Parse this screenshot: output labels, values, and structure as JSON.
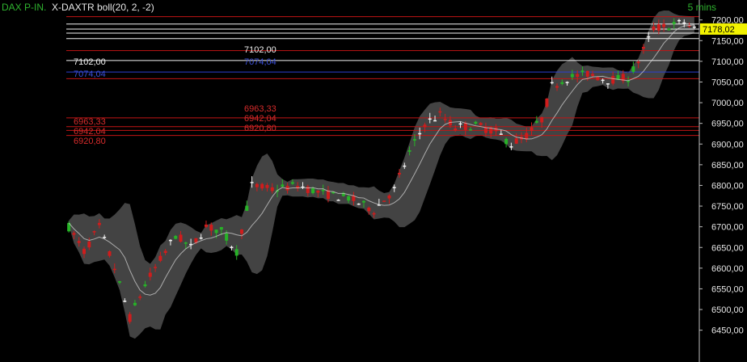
{
  "header": {
    "instrument": "DAX P-IN.",
    "indicator": "X-DAXTR boll(20, 2, -2)",
    "timeframe": "5 mins"
  },
  "colors": {
    "background": "#000000",
    "bull": "#27b327",
    "bear": "#d01c1c",
    "doji": "#f2f2f2",
    "band_fill": "#5a5a5a",
    "middle_band": "#d8d8d8",
    "line_red": "#c21515",
    "line_white": "#f4f4f4",
    "line_blue": "#2c3fd0",
    "current_price_bg": "#f2f200"
  },
  "chart_data": {
    "type": "candlestick",
    "ylim": [
      6420,
      7215
    ],
    "y_ticks": [
      "7200,00",
      "7150,00",
      "7100,00",
      "7050,00",
      "7000,00",
      "6950,00",
      "6900,00",
      "6850,00",
      "6800,00",
      "6750,00",
      "6700,00",
      "6650,00",
      "6600,00",
      "6550,00",
      "6500,00",
      "6450,00"
    ],
    "current_price": {
      "value": 7178.02,
      "label": "7178,02"
    },
    "horizontal_lines": [
      {
        "value": 7208,
        "color": "red",
        "label": ""
      },
      {
        "value": 7190,
        "color": "white",
        "label": ""
      },
      {
        "value": 7178,
        "color": "white",
        "label": ""
      },
      {
        "value": 7168,
        "color": "white",
        "label": ""
      },
      {
        "value": 7155,
        "color": "white",
        "label": ""
      },
      {
        "value": 7126,
        "color": "red",
        "label": ""
      },
      {
        "value": 7102,
        "color": "white",
        "label": "7102,00"
      },
      {
        "value": 7074.04,
        "color": "blue",
        "label": "7074,04"
      },
      {
        "value": 7058,
        "color": "red",
        "label": ""
      },
      {
        "value": 6963.33,
        "color": "red",
        "label": "6963,33"
      },
      {
        "value": 6942.04,
        "color": "red",
        "label": "6942,04"
      },
      {
        "value": 6933,
        "color": "red",
        "label": ""
      },
      {
        "value": 6920.8,
        "color": "red",
        "label": "6920,80"
      }
    ],
    "price_path": [
      {
        "t": 0,
        "v": 6700
      },
      {
        "t": 3,
        "v": 6640
      },
      {
        "t": 6,
        "v": 6700
      },
      {
        "t": 9,
        "v": 6600
      },
      {
        "t": 12,
        "v": 6480
      },
      {
        "t": 15,
        "v": 6560
      },
      {
        "t": 18,
        "v": 6620
      },
      {
        "t": 21,
        "v": 6680
      },
      {
        "t": 24,
        "v": 6650
      },
      {
        "t": 27,
        "v": 6700
      },
      {
        "t": 30,
        "v": 6690
      },
      {
        "t": 33,
        "v": 6640
      },
      {
        "t": 36,
        "v": 6800
      },
      {
        "t": 40,
        "v": 6790
      },
      {
        "t": 45,
        "v": 6800
      },
      {
        "t": 50,
        "v": 6780
      },
      {
        "t": 55,
        "v": 6770
      },
      {
        "t": 60,
        "v": 6740
      },
      {
        "t": 64,
        "v": 6790
      },
      {
        "t": 67,
        "v": 6880
      },
      {
        "t": 70,
        "v": 6950
      },
      {
        "t": 73,
        "v": 6970
      },
      {
        "t": 76,
        "v": 6940
      },
      {
        "t": 80,
        "v": 6945
      },
      {
        "t": 84,
        "v": 6930
      },
      {
        "t": 87,
        "v": 6900
      },
      {
        "t": 90,
        "v": 6920
      },
      {
        "t": 93,
        "v": 6960
      },
      {
        "t": 95,
        "v": 7040
      },
      {
        "t": 98,
        "v": 7060
      },
      {
        "t": 102,
        "v": 7070
      },
      {
        "t": 106,
        "v": 7055
      },
      {
        "t": 110,
        "v": 7060
      },
      {
        "t": 112,
        "v": 7100
      },
      {
        "t": 115,
        "v": 7180
      },
      {
        "t": 118,
        "v": 7185
      },
      {
        "t": 121,
        "v": 7195
      },
      {
        "t": 123,
        "v": 7178
      }
    ]
  }
}
